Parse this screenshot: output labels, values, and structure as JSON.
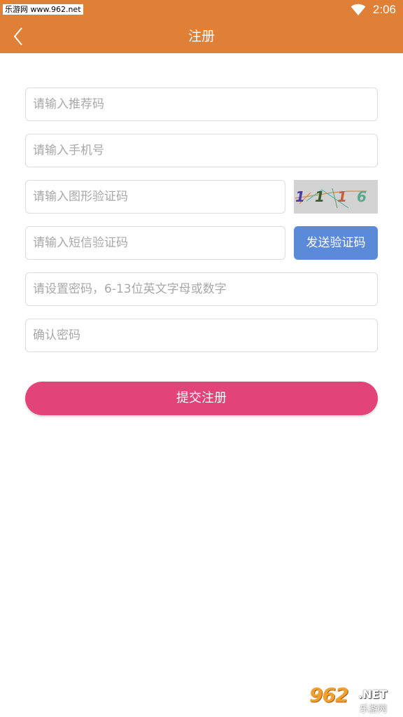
{
  "status_bar": {
    "watermark": "乐游网 www.962.net",
    "time": "2:06",
    "icons": [
      "wifi-icon",
      "signal-icon"
    ]
  },
  "app_bar": {
    "title": "注册",
    "back_icon": "chevron-left-icon"
  },
  "form": {
    "referral_code_placeholder": "请输入推荐码",
    "phone_placeholder": "请输入手机号",
    "image_captcha_placeholder": "请输入图形验证码",
    "sms_code_placeholder": "请输入短信验证码",
    "password_placeholder": "请设置密码，6-13位英文字母或数字",
    "confirm_password_placeholder": "确认密码",
    "captcha_digits": [
      "1",
      "1",
      "1",
      "6"
    ],
    "send_code_label": "发送验证码",
    "submit_label": "提交注册"
  },
  "watermark_logo": {
    "number": "962",
    "domain": ".NET",
    "name": "乐游网"
  },
  "colors": {
    "header": "#e07f36",
    "send_button": "#5b8ad9",
    "submit_button": "#e24379"
  }
}
